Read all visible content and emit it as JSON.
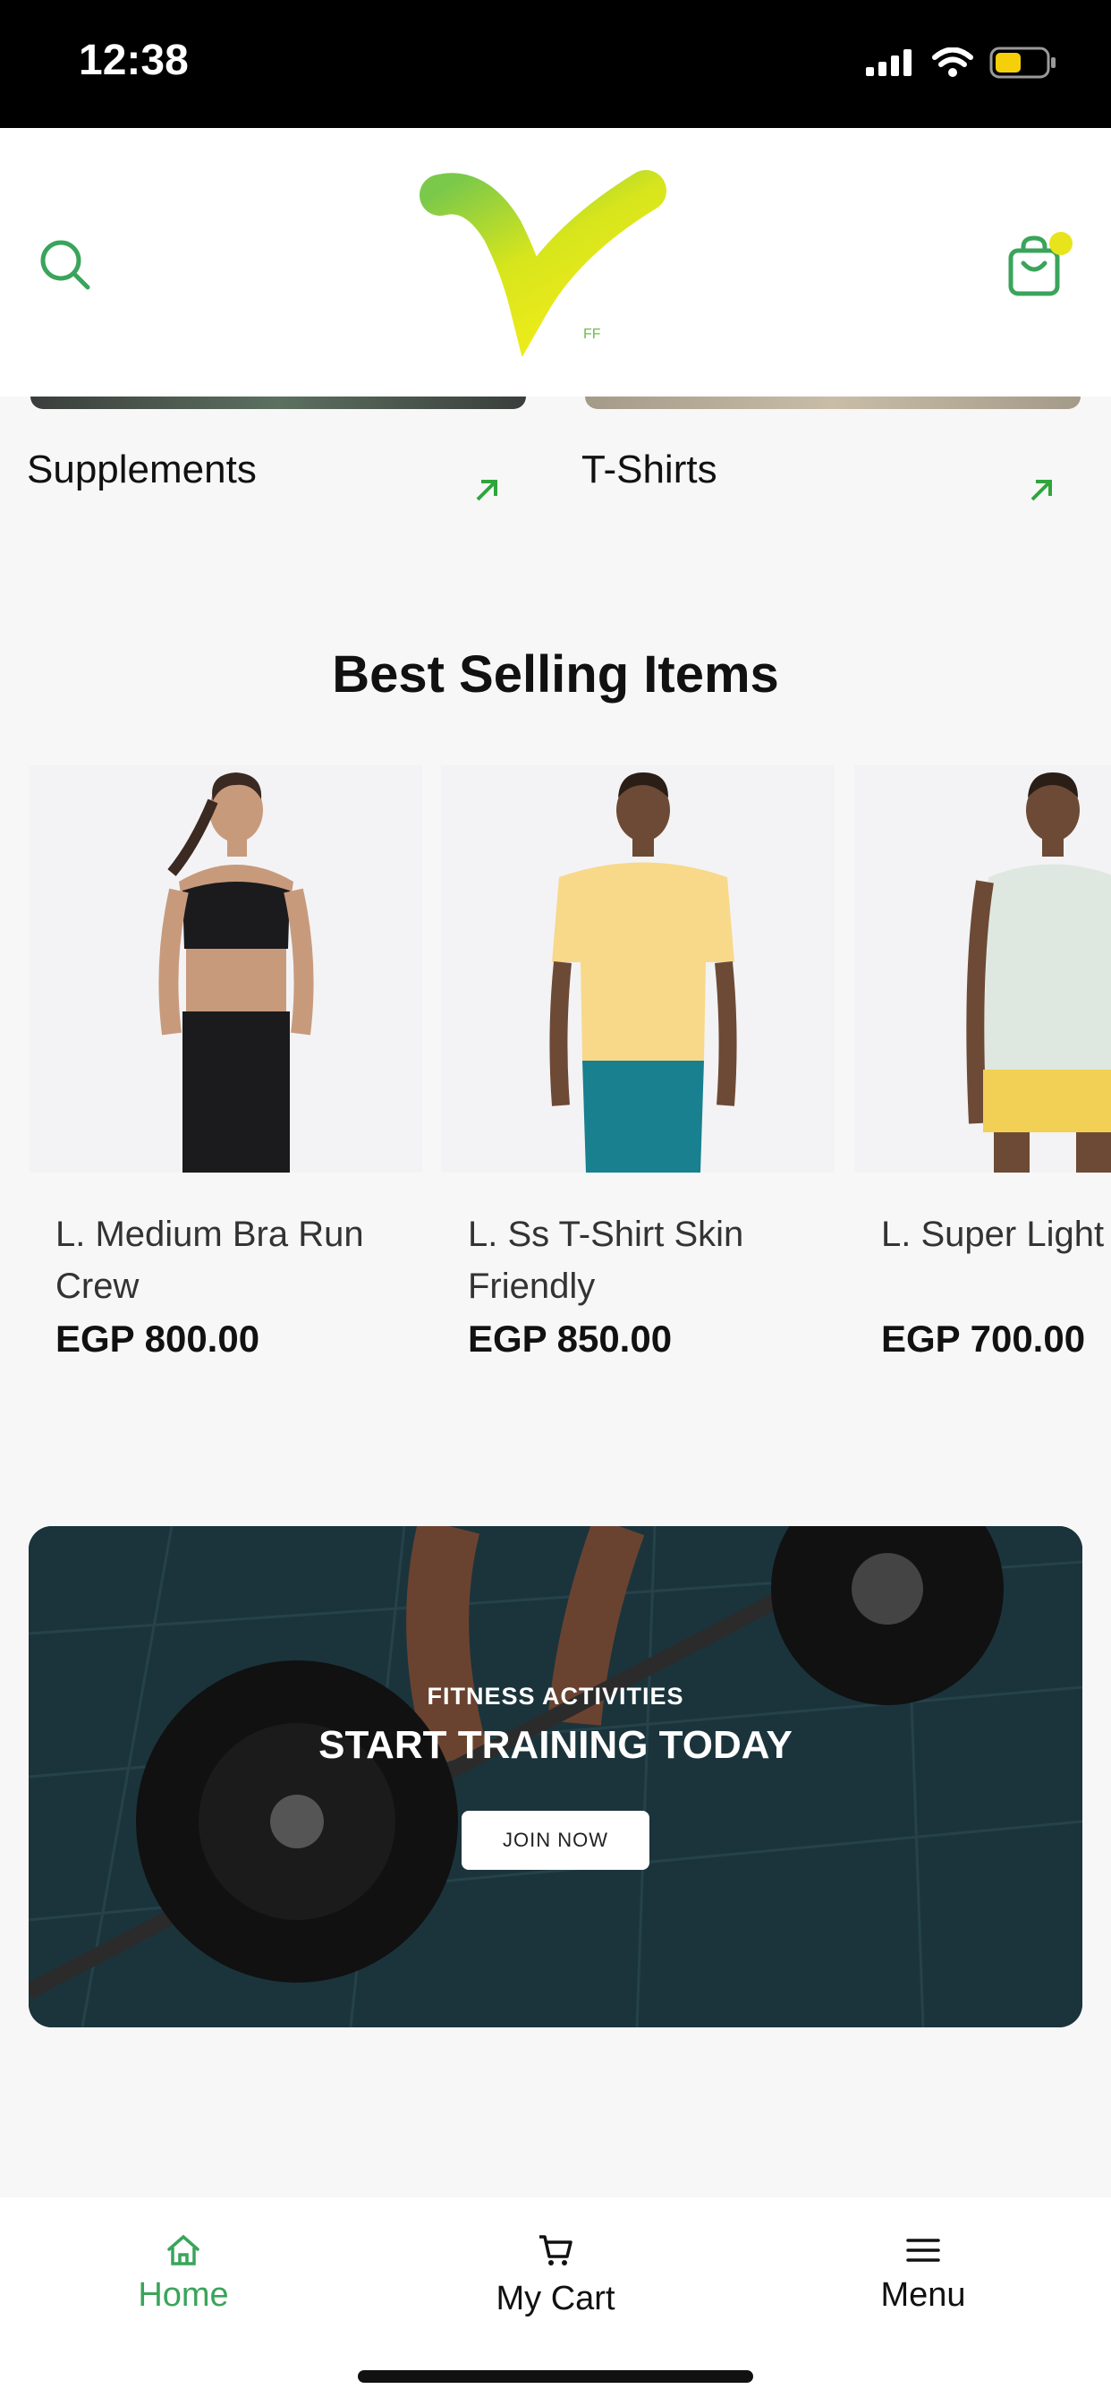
{
  "status_bar": {
    "time": "12:38"
  },
  "categories": [
    {
      "label": "Supplements"
    },
    {
      "label": "T-Shirts"
    }
  ],
  "best_selling": {
    "title": "Best Selling Items",
    "products": [
      {
        "name_line1": "L. Medium Bra Run",
        "name_line2": "Crew",
        "price": "EGP 800.00"
      },
      {
        "name_line1": "L. Ss T-Shirt Skin",
        "name_line2": "Friendly",
        "price": "EGP 850.00"
      },
      {
        "name_line1": "L. Super Light",
        "name_line2": "",
        "price": "EGP 700.00"
      }
    ]
  },
  "banner": {
    "subtitle": "FITNESS ACTIVITIES",
    "title": "START TRAINING TODAY",
    "button": "JOIN NOW"
  },
  "bottom_nav": {
    "home": "Home",
    "cart": "My Cart",
    "menu": "Menu"
  },
  "colors": {
    "accent_green": "#3aa45b",
    "logo_yellow": "#e4e619",
    "cart_badge": "#e8e41c"
  }
}
